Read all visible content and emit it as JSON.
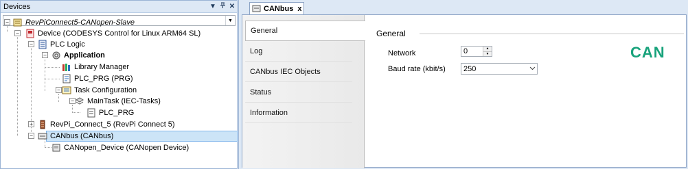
{
  "devices": {
    "title": "Devices",
    "pin_glyph": "▼",
    "pin2_glyph": "ᵽ",
    "close_glyph": "✕",
    "combo_value": "",
    "tree": {
      "root": "RevPiConnect5-CANopen-Slave",
      "device": "Device (CODESYS Control for Linux ARM64 SL)",
      "plc_logic": "PLC Logic",
      "application": "Application",
      "library_manager": "Library Manager",
      "plc_prg": "PLC_PRG (PRG)",
      "task_config": "Task Configuration",
      "main_task": "MainTask (IEC-Tasks)",
      "plc_prg_call": "PLC_PRG",
      "revpi": "RevPi_Connect_5 (RevPi Connect 5)",
      "canbus": "CANbus (CANbus)",
      "canopen_device": "CANopen_Device (CANopen Device)"
    }
  },
  "editor": {
    "tab_label": "CANbus",
    "tab_close": "x",
    "vtabs": [
      "General",
      "Log",
      "CANbus IEC Objects",
      "Status",
      "Information"
    ],
    "group_title": "General",
    "network_label": "Network",
    "network_value": "0",
    "baud_label": "Baud rate (kbit/s)",
    "baud_value": "250",
    "logo_text": "CAN"
  },
  "colors": {
    "header_bg": "#dde8f5",
    "selection_bg": "#cce4f7",
    "can_logo": "#19a37c"
  }
}
